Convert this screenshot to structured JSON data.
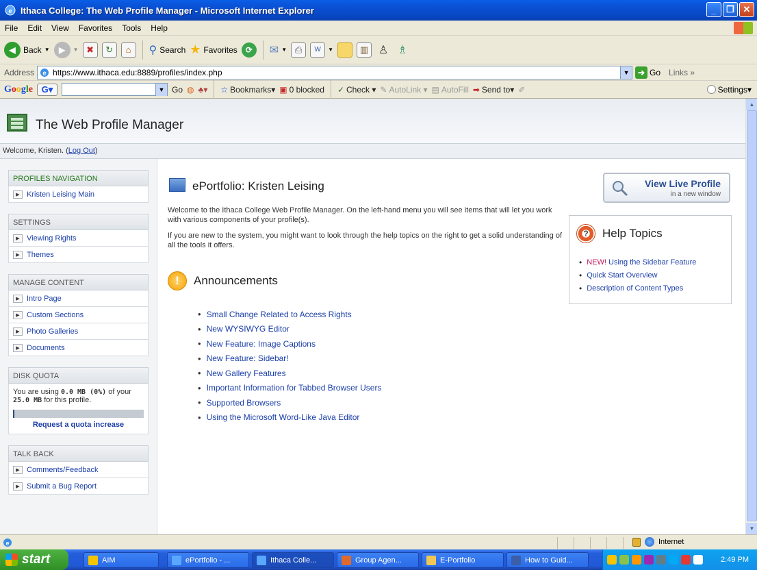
{
  "window": {
    "title": "Ithaca College: The Web Profile Manager - Microsoft Internet Explorer",
    "minimize": "_",
    "restore": "❐",
    "close": "✕"
  },
  "menu": [
    "File",
    "Edit",
    "View",
    "Favorites",
    "Tools",
    "Help"
  ],
  "toolbar": {
    "back_label": "Back",
    "search_label": "Search",
    "favorites_label": "Favorites"
  },
  "address": {
    "label": "Address",
    "url": "https://www.ithaca.edu:8889/profiles/index.php",
    "go_label": "Go",
    "links_label": "Links »"
  },
  "googlebar": {
    "go_label": "Go",
    "bookmarks_label": "Bookmarks▾",
    "blocked_label": "0 blocked",
    "check_label": "Check ▾",
    "autolink_label": "AutoLink ▾",
    "autofill_label": "AutoFill",
    "sendto_label": "Send to▾",
    "settings_label": "Settings▾"
  },
  "page": {
    "header_title": "The Web Profile Manager",
    "welcome_text": "Welcome, Kristen. (",
    "logout_label": "Log Out",
    "welcome_end": ")"
  },
  "sidebar": {
    "profiles_nav_title": "PROFILES NAVIGATION",
    "profiles_items": [
      "Kristen Leising Main"
    ],
    "settings_title": "SETTINGS",
    "settings_items": [
      "Viewing Rights",
      "Themes"
    ],
    "manage_title": "MANAGE CONTENT",
    "manage_items": [
      "Intro Page",
      "Custom Sections",
      "Photo Galleries",
      "Documents"
    ],
    "quota_title": "DISK QUOTA",
    "quota_text_1": "You are using ",
    "quota_used": "0.0 MB (0%)",
    "quota_text_2": " of your ",
    "quota_total": "25.0 MB",
    "quota_text_3": " for this profile.",
    "quota_fraction": 0.0,
    "quota_link": "Request a quota increase",
    "talkback_title": "TALK BACK",
    "talkback_items": [
      "Comments/Feedback",
      "Submit a Bug Report"
    ]
  },
  "main": {
    "title": "ePortfolio: Kristen Leising",
    "intro_p1": "Welcome to the Ithaca College Web Profile Manager. On the left-hand menu you will see items that will let you work with various components of your profile(s).",
    "intro_p2": "If you are new to the system, you might want to look through the help topics on the right to get a solid understanding of all the tools it offers.",
    "announcements_title": "Announcements",
    "announcements": [
      "Small Change Related to Access Rights",
      "New WYSIWYG Editor",
      "New Feature: Image Captions",
      "New Feature: Sidebar!",
      "New Gallery Features",
      "Important Information for Tabbed Browser Users",
      "Supported Browsers",
      "Using the Microsoft Word-Like Java Editor"
    ],
    "live_profile_title": "View Live Profile",
    "live_profile_sub": "in a new window",
    "help_title": "Help Topics",
    "help_new_tag": "NEW!",
    "help_items": [
      "Using the Sidebar Feature",
      "Quick Start Overview",
      "Description of Content Types"
    ]
  },
  "status": {
    "zone": "Internet"
  },
  "taskbar": {
    "start_label": "start",
    "tasks": [
      "AIM",
      "ePortfolio - ...",
      "Ithaca Colle...",
      "Group Agen...",
      "E-Portfolio",
      "How to Guid..."
    ],
    "clock": "2:49 PM"
  },
  "colors": {
    "link": "#1a3ea8",
    "xp_blue": "#0a52d6",
    "new_tag": "#c2185b"
  }
}
